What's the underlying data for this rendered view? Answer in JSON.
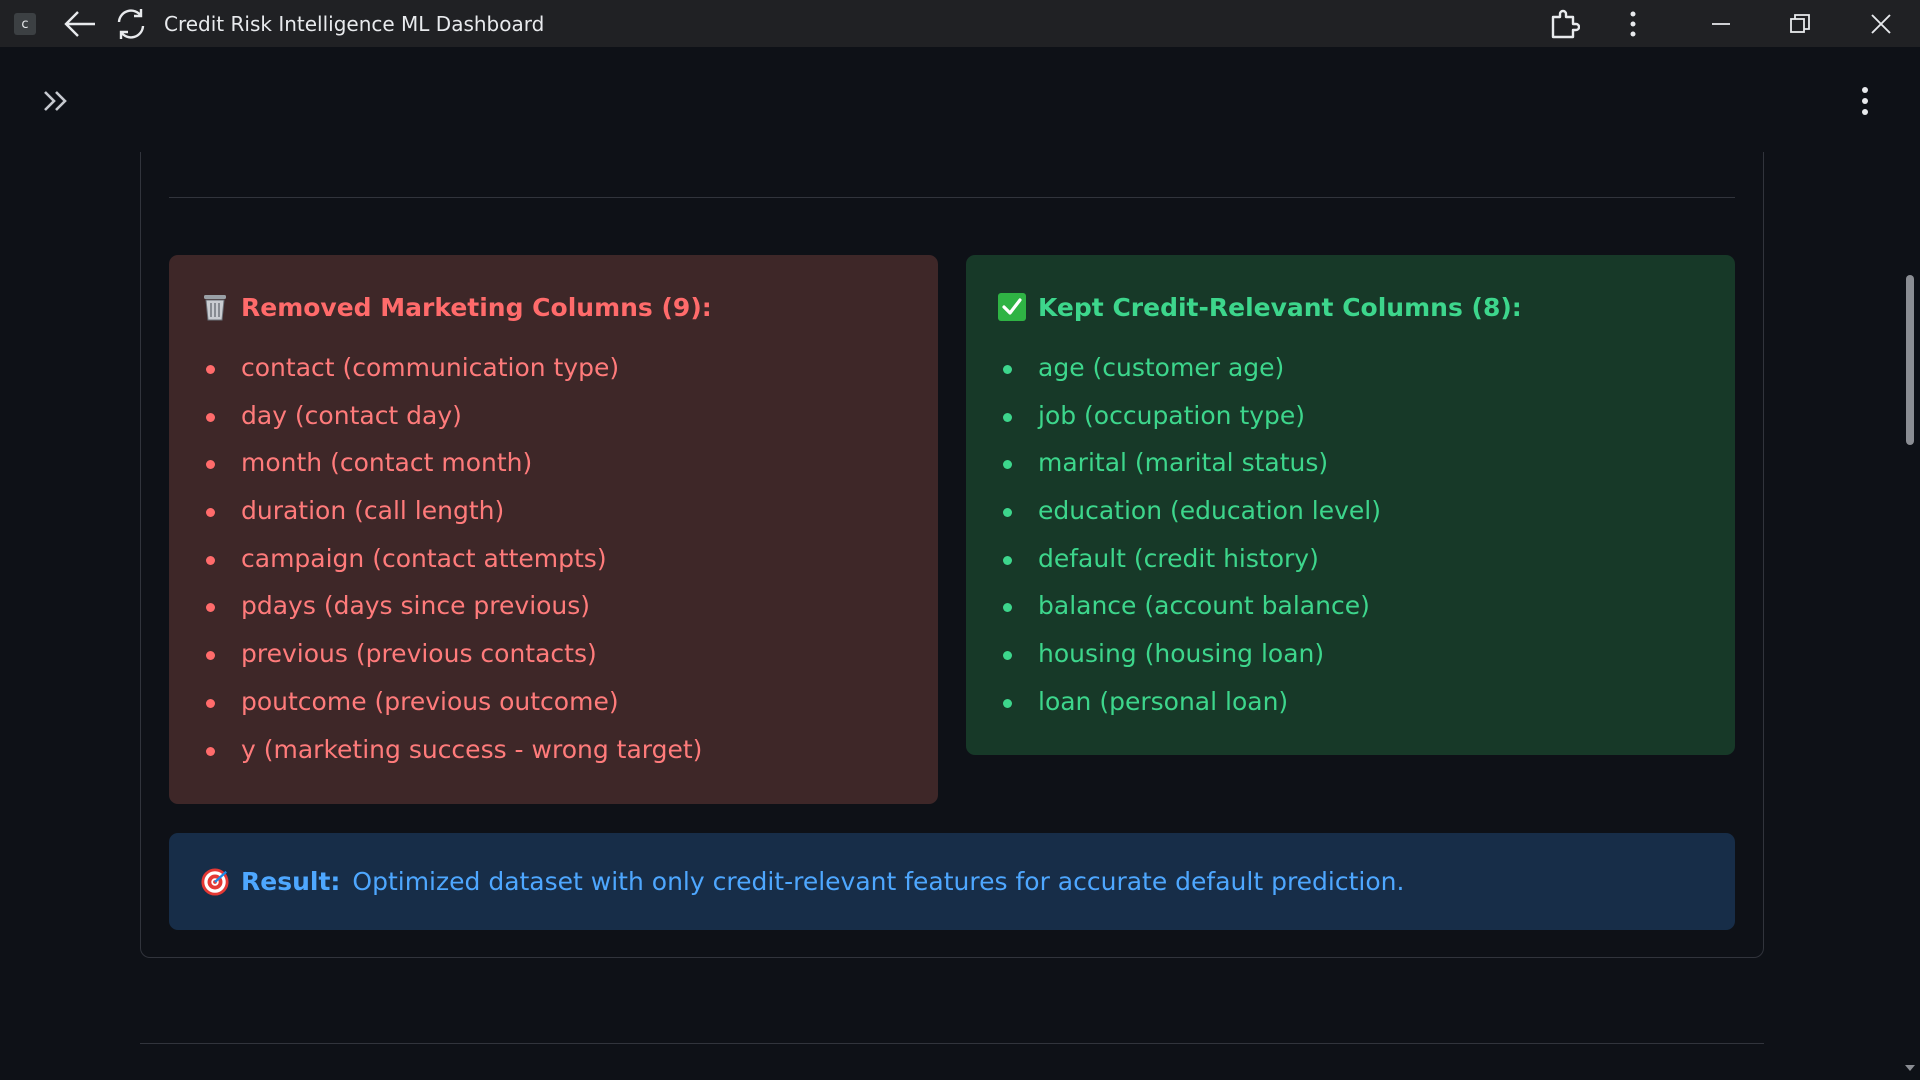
{
  "window": {
    "app_badge": "c",
    "title": "Credit Risk Intelligence ML Dashboard"
  },
  "removed": {
    "title": "Removed Marketing Columns (9):",
    "icon": "wastebasket-icon",
    "items": [
      "contact (communication type)",
      "day (contact day)",
      "month (contact month)",
      "duration (call length)",
      "campaign (contact attempts)",
      "pdays (days since previous)",
      "previous (previous contacts)",
      "poutcome (previous outcome)",
      "y (marketing success - wrong target)"
    ]
  },
  "kept": {
    "title": "Kept Credit-Relevant Columns (8):",
    "icon": "check-mark-icon",
    "items": [
      "age (customer age)",
      "job (occupation type)",
      "marital (marital status)",
      "education (education level)",
      "default (credit history)",
      "balance (account balance)",
      "housing (housing loan)",
      "loan (personal loan)"
    ]
  },
  "result": {
    "icon": "target-icon",
    "label": "Result:",
    "text": "Optimized dataset with only credit-relevant features for accurate default prediction."
  },
  "colors": {
    "background": "#0e1117",
    "removed_bg": "#3e2728",
    "removed_text": "#ff6b6b",
    "kept_bg": "#173928",
    "kept_text": "#3dd68c",
    "result_bg": "#172d48",
    "result_text": "#4ea7ff"
  }
}
